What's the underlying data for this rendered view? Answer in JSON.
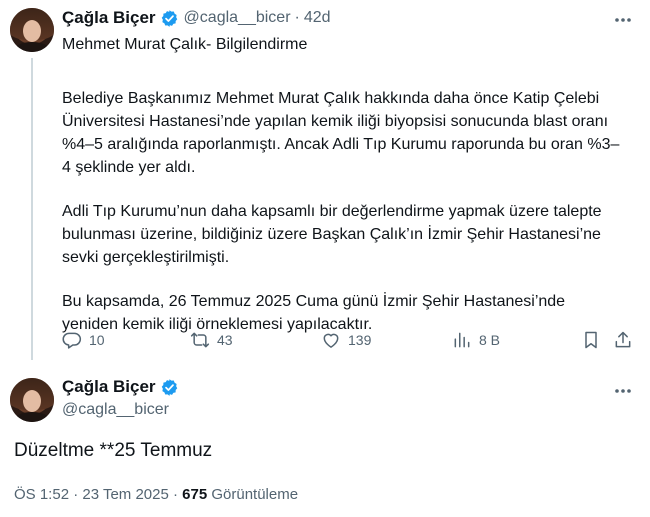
{
  "tweet1": {
    "display_name": "Çağla Biçer",
    "handle": "@cagla__bicer",
    "separator": "·",
    "time": "42d",
    "title": "Mehmet Murat Çalık- Bilgilendirme",
    "paragraphs": [
      "Belediye Başkanımız Mehmet Murat Çalık hakkında daha önce Katip Çelebi Üniversitesi Hastanesi’nde yapılan kemik iliği biyopsisi sonucunda blast oranı %4–5 aralığında raporlanmıştı. Ancak Adli Tıp Kurumu raporunda bu oran %3–4 şeklinde yer aldı.",
      "Adli Tıp Kurumu’nun daha kapsamlı bir değerlendirme yapmak üzere talepte bulunması üzerine, bildiğiniz üzere Başkan Çalık’ın İzmir Şehir Hastanesi’ne sevki gerçekleştirilmişti.",
      "Bu kapsamda, 26 Temmuz 2025 Cuma günü İzmir Şehir Hastanesi’nde yeniden kemik iliği örneklemesi yapılacaktır."
    ],
    "actions": {
      "replies": "10",
      "retweets": "43",
      "likes": "139",
      "views": "8 B"
    }
  },
  "tweet2": {
    "display_name": "Çağla Biçer",
    "handle": "@cagla__bicer",
    "text": "Düzeltme **25 Temmuz",
    "timestamp": "ÖS 1:52 · 23 Tem 2025 ·",
    "view_count": "675",
    "view_label": "Görüntüleme"
  },
  "colors": {
    "verified_blue": "#1d9bf0",
    "secondary_text": "#536471",
    "thread_line": "#cfd9de"
  }
}
